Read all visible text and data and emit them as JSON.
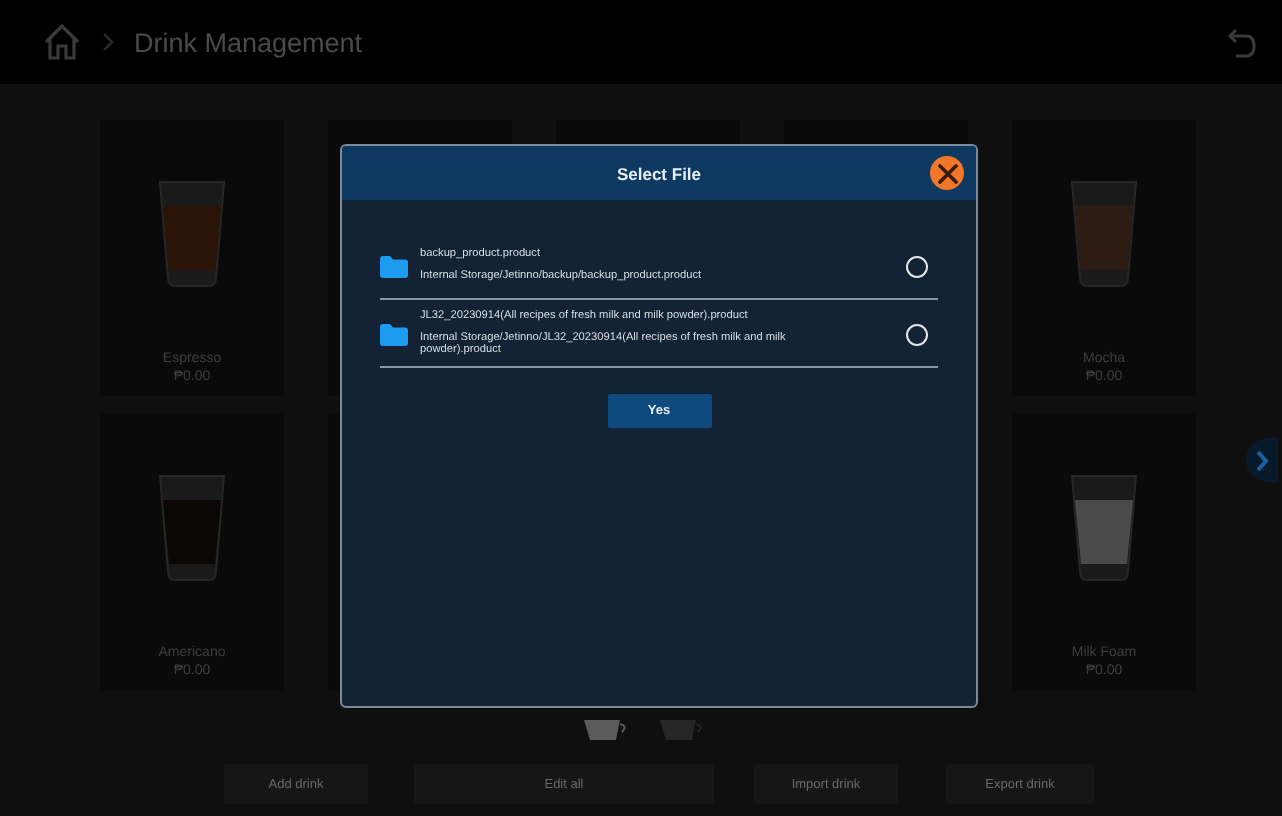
{
  "header": {
    "title": "Drink Management"
  },
  "drinks": [
    {
      "name": "Espresso",
      "price": "₱0.00",
      "color": "#2a1408"
    },
    {
      "name": "Mocha",
      "price": "₱0.00",
      "color": "#2c1c14"
    },
    {
      "name": "Americano",
      "price": "₱0.00",
      "color": "#0c0604"
    },
    {
      "name": "Milk Foam",
      "price": "₱0.00",
      "color": "#4a4a4a"
    }
  ],
  "pager": [
    {
      "selected": true
    },
    {
      "selected": false
    }
  ],
  "actions": [
    "Add drink",
    "Edit all",
    "Import drink",
    "Export drink"
  ],
  "dialog": {
    "title": "Select File",
    "files": [
      {
        "name": "backup_product.product",
        "path": "Internal Storage/Jetinno/backup/backup_product.product",
        "selected": false
      },
      {
        "name": "JL32_20230914(All recipes of fresh milk and milk powder).product",
        "path": "Internal Storage/Jetinno/JL32_20230914(All recipes of fresh milk and milk powder).product",
        "selected": false
      }
    ],
    "confirm": "Yes"
  }
}
